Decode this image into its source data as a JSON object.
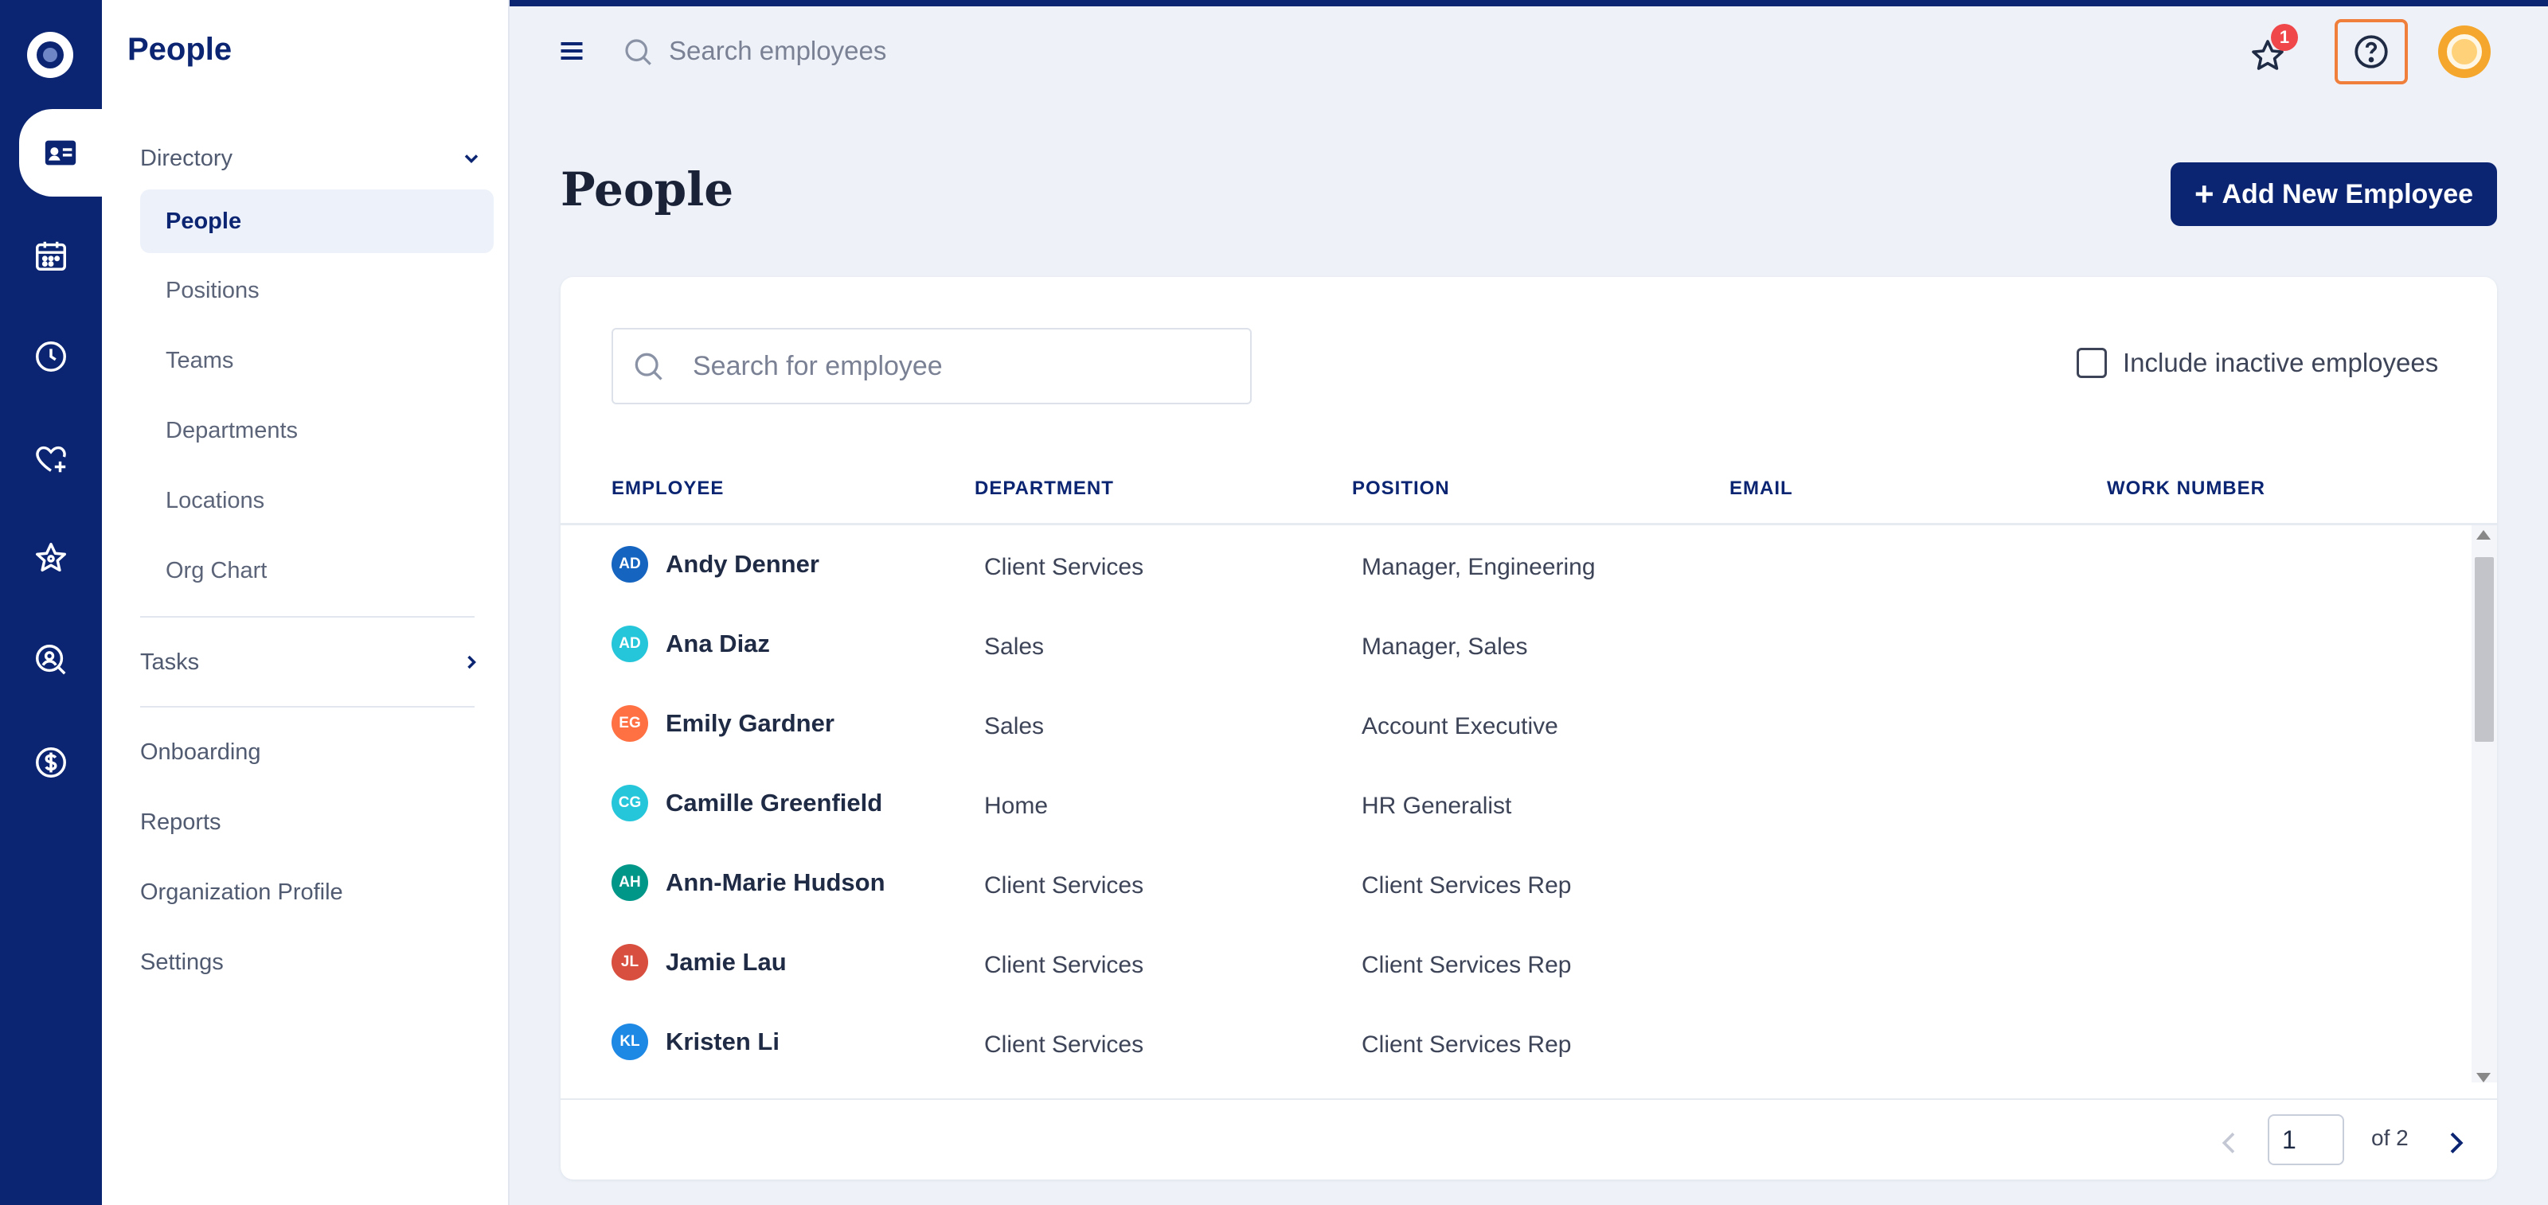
{
  "sidebar": {
    "title": "People",
    "directory_label": "Directory",
    "directory_items": [
      "People",
      "Positions",
      "Teams",
      "Departments",
      "Locations",
      "Org Chart"
    ],
    "tasks_label": "Tasks",
    "links": [
      "Onboarding",
      "Reports",
      "Organization Profile",
      "Settings"
    ]
  },
  "rail": {
    "icons": [
      "people-card-icon",
      "calendar-icon",
      "clock-icon",
      "heart-plus-icon",
      "star-icon",
      "search-person-icon",
      "dollar-icon"
    ]
  },
  "topbar": {
    "search_placeholder": "Search employees",
    "notification_count": "1"
  },
  "main": {
    "title": "People",
    "add_button_label": "Add New Employee",
    "add_button_plus": "+",
    "search_placeholder": "Search for employee",
    "inactive_label": "Include inactive employees",
    "inactive_checked": false
  },
  "table": {
    "headers": [
      "EMPLOYEE",
      "DEPARTMENT",
      "POSITION",
      "EMAIL",
      "WORK NUMBER"
    ],
    "rows": [
      {
        "initials": "AD",
        "name": "Andy Denner",
        "department": "Client Services",
        "position": "Manager, Engineering",
        "color": "#1565c0"
      },
      {
        "initials": "AD",
        "name": "Ana Diaz",
        "department": "Sales",
        "position": "Manager, Sales",
        "color": "#26c6da"
      },
      {
        "initials": "EG",
        "name": "Emily Gardner",
        "department": "Sales",
        "position": "Account Executive",
        "color": "#ff7043"
      },
      {
        "initials": "CG",
        "name": "Camille Greenfield",
        "department": "Home",
        "position": "HR Generalist",
        "color": "#26c6da"
      },
      {
        "initials": "AH",
        "name": "Ann-Marie Hudson",
        "department": "Client Services",
        "position": "Client Services Rep",
        "color": "#009688"
      },
      {
        "initials": "JL",
        "name": "Jamie Lau",
        "department": "Client Services",
        "position": "Client Services Rep",
        "color": "#d84f3f"
      },
      {
        "initials": "KL",
        "name": "Kristen Li",
        "department": "Client Services",
        "position": "Client Services Rep",
        "color": "#1e88e5"
      }
    ]
  },
  "pagination": {
    "current_page": "1",
    "of_label": "of 2"
  },
  "colors": {
    "brand_navy": "#0b2572",
    "help_highlight": "#f07f3c",
    "badge_red": "#f0474b",
    "avatar_orange": "#f4a72c"
  }
}
